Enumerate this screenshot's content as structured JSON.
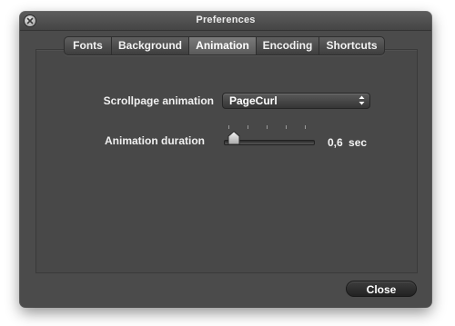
{
  "window": {
    "title": "Preferences"
  },
  "tabs": [
    {
      "label": "Fonts",
      "selected": false
    },
    {
      "label": "Background",
      "selected": false
    },
    {
      "label": "Animation",
      "selected": true
    },
    {
      "label": "Encoding",
      "selected": false
    },
    {
      "label": "Shortcuts",
      "selected": false
    }
  ],
  "animation": {
    "scrollpage_label": "Scrollpage animation",
    "scrollpage_value": "PageCurl",
    "duration_label": "Animation duration",
    "duration_value": "0,6",
    "duration_unit": "sec",
    "duration_fraction": 0.05
  },
  "footer": {
    "close_label": "Close"
  },
  "colors": {
    "window_bg": "#4b4b4b",
    "text": "#f0f0f0"
  },
  "icons": {
    "window_close": "close-icon",
    "popup": "updown-arrows-icon",
    "slider": "slider-knob-icon"
  }
}
